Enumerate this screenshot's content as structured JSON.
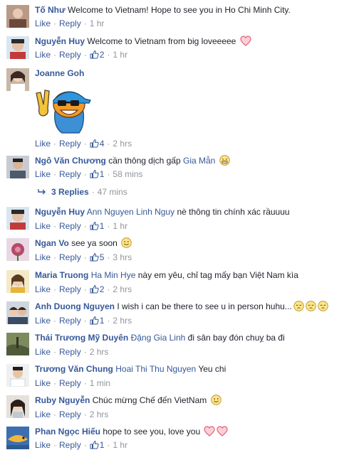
{
  "labels": {
    "like": "Like",
    "reply": "Reply",
    "sep": "·"
  },
  "colors": {
    "link": "#365899",
    "text": "#1d2129",
    "meta": "#90949c"
  },
  "comments": [
    {
      "author": "Tố Như",
      "text": "Welcome to Vietnam! Hope to see you in Ho Chi Minh City.",
      "time": "1 hr"
    },
    {
      "author": "Nguyễn Huy",
      "text": "Welcome to Vietnam from big loveeeee",
      "emoji": "heart-outline-icon",
      "likes": "2",
      "time": "1 hr"
    },
    {
      "author": "Joanne Goh",
      "sticker": "peace-sign-sticker",
      "likes": "4",
      "time": "2 hrs"
    },
    {
      "author": "Ngô Văn Chương",
      "text": "cần thông dịch gấp",
      "tag": "Gia Mẫn",
      "emoji": "grin-face-icon",
      "likes": "1",
      "time": "58 mins",
      "replies": {
        "label": "3 Replies",
        "time": "47 mins"
      }
    },
    {
      "author": "Nguyễn Huy",
      "tag": "Ann Nguyen Linh Nguy",
      "text": "nè thông tin chính xác rầuuuu",
      "likes": "1",
      "time": "1 hr"
    },
    {
      "author": "Ngan Vo",
      "text": "see ya soon",
      "emoji": "smile-face-icon",
      "likes": "5",
      "time": "3 hrs"
    },
    {
      "author": "Maria Truong",
      "tag": "Ha Min Hye",
      "text": "này em yêu, chỉ tag mấy bạn Việt Nam kìa",
      "likes": "2",
      "time": "2 hrs"
    },
    {
      "author": "Anh Duong Nguyen",
      "text": "I wish i can be there to see u in person huhu...",
      "emoji": "pensive-face-icon",
      "likes": "1",
      "time": "2 hrs"
    },
    {
      "author": "Thái Trương Mỹ Duyên",
      "tag": "Đặng Gia Linh",
      "text": "đi sân bay đón chuỵ ba đi",
      "time": "2 hrs"
    },
    {
      "author": "Trương Văn Chung",
      "tag": "Hoai Thi Thu Nguyen",
      "text": "Yeu chi",
      "time": "1 min"
    },
    {
      "author": "Ruby Nguyễn",
      "text": "Chúc mừng Chế đến VietNam",
      "emoji": "smile-face-icon",
      "time": "2 hrs"
    },
    {
      "author": "Phan Ngọc Hiếu",
      "text": "hope to see you, love you",
      "emoji": "heart-outline-icon",
      "likes": "1",
      "time": "1 hr"
    }
  ]
}
